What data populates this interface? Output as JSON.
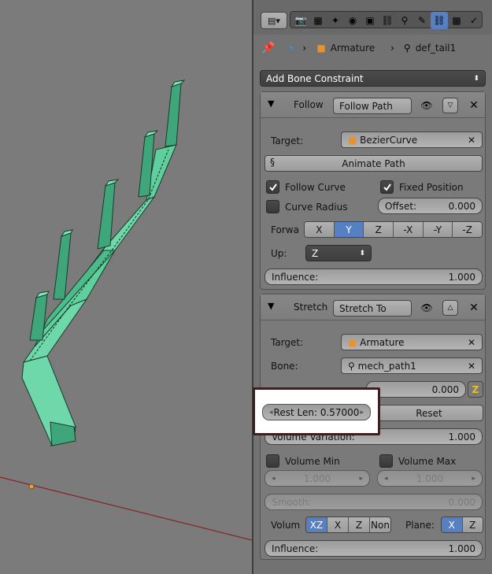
{
  "header": {
    "breadcrumb": {
      "armature": "Armature",
      "bone": "def_tail1"
    }
  },
  "add_constraint": {
    "label": "Add Bone Constraint"
  },
  "follow_path": {
    "header_label": "Follow",
    "name": "Follow Path",
    "target_label": "Target:",
    "target_value": "BezierCurve",
    "animate_path": "Animate Path",
    "follow_curve": "Follow Curve",
    "fixed_position": "Fixed Position",
    "curve_radius": "Curve Radius",
    "offset_label": "Offset:",
    "offset_value": "0.000",
    "forward_label": "Forwa",
    "forward_axes": [
      "X",
      "Y",
      "Z",
      "-X",
      "-Y",
      "-Z"
    ],
    "forward_selected": "Y",
    "up_label": "Up:",
    "up_value": "Z",
    "influence_label": "Influence:",
    "influence_value": "1.000"
  },
  "stretch_to": {
    "header_label": "Stretch",
    "name": "Stretch To",
    "target_label": "Target:",
    "target_value": "Armature",
    "bone_label": "Bone:",
    "bone_value": "mech_path1",
    "head_tail_value": "0.000",
    "rest_len": "Rest Len: 0.57000",
    "reset": "Reset",
    "volume_variation_label": "Volume Variation:",
    "volume_variation_value": "1.000",
    "volume_min": "Volume Min",
    "volume_max": "Volume Max",
    "vol_min_value": "1.000",
    "vol_max_value": "1.000",
    "smooth_label": "Smooth:",
    "smooth_value": "0.000",
    "volume_label": "Volum",
    "volume_modes": [
      "XZ",
      "X",
      "Z",
      "Non"
    ],
    "volume_selected": "XZ",
    "plane_label": "Plane:",
    "plane_modes": [
      "X",
      "Z"
    ],
    "plane_selected": "X",
    "influence_label": "Influence:",
    "influence_value": "1.000"
  },
  "colors": {
    "accent": "#5680c2",
    "bone_fill": "#5fcf9e",
    "highlight_border": "#3b2020"
  }
}
